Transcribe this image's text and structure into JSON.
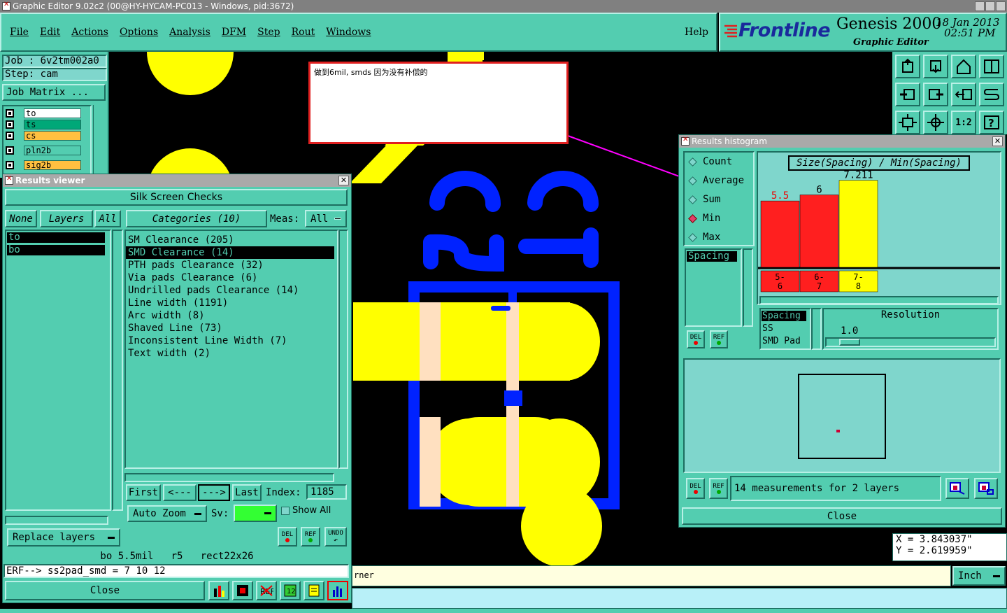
{
  "window_title": "Graphic Editor 9.02c2 (00@HY-HYCAM-PC013 - Windows, pid:3672)",
  "menu": [
    "File",
    "Edit",
    "Actions",
    "Options",
    "Analysis",
    "DFM",
    "Step",
    "Rout",
    "Windows"
  ],
  "help": "Help",
  "brand": {
    "logo": "Frontline",
    "product": "Genesis 2000",
    "subtitle": "Graphic Editor",
    "date": "18 Jan 2013",
    "time": "02:51 PM"
  },
  "job": {
    "job": "Job : 6v2tm002a0",
    "step": "Step: cam",
    "job_matrix": "Job Matrix ..."
  },
  "layers": [
    "to",
    "ts",
    "cs",
    "pln2b",
    "sig2b"
  ],
  "annotation": "做到6mil, smds 因为没有补偿的",
  "results_viewer": {
    "title": "Results viewer",
    "header": "Silk Screen Checks",
    "btn_none": "None",
    "btn_layers": "Layers",
    "btn_all": "All",
    "categories_label": "Categories (10)",
    "meas_label": "Meas:",
    "meas_value": "All",
    "layer_list": [
      "to",
      "bo"
    ],
    "categories": [
      "SM Clearance (205)",
      "SMD Clearance (14)",
      "PTH pads Clearance (32)",
      "Via pads Clearance (6)",
      "Undrilled pads Clearance (14)",
      "Line width (1191)",
      "Arc width (8)",
      "Shaved Line (73)",
      "Inconsistent Line Width (7)",
      "Text width (2)"
    ],
    "nav": {
      "first": "First",
      "prev": "<---",
      "next": "--->",
      "last": "Last",
      "index_label": "Index:",
      "index_value": "1185"
    },
    "auto_zoom": "Auto Zoom",
    "sv_label": "Sv:",
    "show_all": "Show All",
    "del": "DEL",
    "ref": "REF",
    "undo": "UNDO",
    "replace_layers": "Replace layers",
    "status": "bo 5.5mil   r5   rect22x26",
    "erf": "ERF--> ss2pad_smd = 7 10 12",
    "close": "Close"
  },
  "histogram": {
    "title": "Results histogram",
    "options": [
      "Count",
      "Average",
      "Sum",
      "Min",
      "Max"
    ],
    "selected": "Min",
    "list_left": [
      "Spacing"
    ],
    "del": "DEL",
    "ref": "REF",
    "chart_title": "Size(Spacing) / Min(Spacing)",
    "list_right": [
      "Spacing",
      "SS",
      "SMD Pad"
    ],
    "resolution_label": "Resolution",
    "resolution_value": "1.0",
    "summary": "14 measurements for 2 layers",
    "close": "Close"
  },
  "chart_data": {
    "type": "bar",
    "title": "Size(Spacing) / Min(Spacing)",
    "categories": [
      "5-6",
      "6-7",
      "7-8"
    ],
    "values": [
      5.5,
      6,
      7.211
    ],
    "value_labels": [
      "5.5",
      "6",
      "7.211"
    ],
    "category_labels": [
      [
        "5-",
        "6"
      ],
      [
        "6-",
        "7"
      ],
      [
        "7-",
        "8"
      ]
    ],
    "colors": [
      "#ff1f1f",
      "#ff1f1f",
      "#ffff00"
    ],
    "ylim": [
      0,
      8
    ]
  },
  "coords": {
    "x": "X = 3.843037\"",
    "y": "Y = 2.619959\""
  },
  "bottom_prompt": "rner",
  "units": "Inch"
}
